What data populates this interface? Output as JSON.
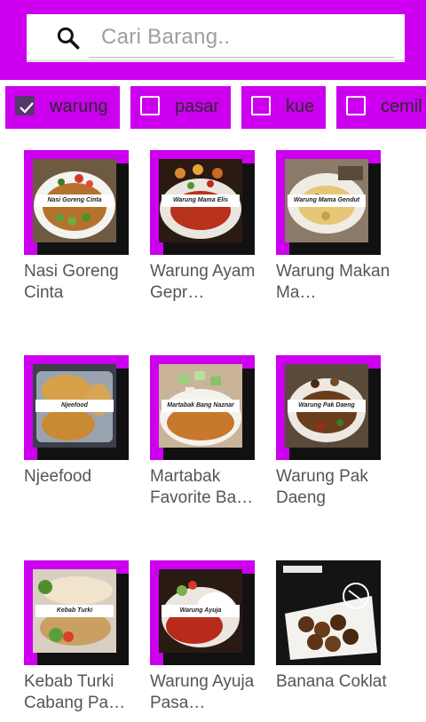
{
  "search": {
    "placeholder": "Cari Barang.."
  },
  "categories": [
    {
      "label": "warung",
      "checked": true
    },
    {
      "label": "pasar",
      "checked": false
    },
    {
      "label": "kue",
      "checked": false
    },
    {
      "label": "cemil",
      "checked": false
    }
  ],
  "items": [
    {
      "title": "Nasi Goreng Cinta",
      "photo_label": "Nasi Goreng Cinta"
    },
    {
      "title": "Warung Ayam Gepr…",
      "photo_label": "Warung Mama Elis"
    },
    {
      "title": "Warung Makan Ma…",
      "photo_label": "Warung Mama Gendut"
    },
    {
      "title": "Njeefood",
      "photo_label": "Njeefood"
    },
    {
      "title": "Martabak Favorite Ba…",
      "photo_label": "Martabak Bang Naznar"
    },
    {
      "title": "Warung Pak Daeng",
      "photo_label": "Warung Pak Daeng"
    },
    {
      "title": "Kebab Turki Cabang Pa…",
      "photo_label": "Kebab Turki"
    },
    {
      "title": "Warung Ayuja Pasa…",
      "photo_label": "Warung Ayuja"
    },
    {
      "title": "Banana Coklat",
      "photo_label": ""
    }
  ],
  "colors": {
    "accent": "#CC00EE",
    "check": "#55386a"
  }
}
